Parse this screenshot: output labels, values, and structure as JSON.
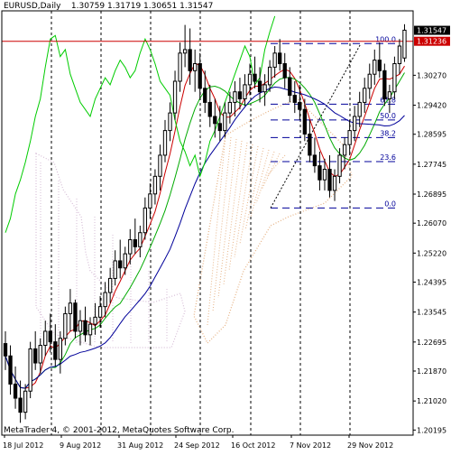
{
  "header": {
    "symbol_timeframe": "EURUSD,Daily",
    "ohlc": "1.30759 1.31719 1.30651 1.31547"
  },
  "footer": {
    "copyright": "MetaTrader 4, © 2001-2012, MetaQuotes Software Corp."
  },
  "colors": {
    "candles": "#000000",
    "ma_fast": "#cc0000",
    "ma_slow": "#000099",
    "chikou": "#00cc00",
    "cloud_up": "#e7b487",
    "cloud_down": "#d6bcd6",
    "bid_line": "#cc0000",
    "fib": "#000099",
    "axis": "#000000"
  },
  "chart_data": {
    "type": "candlestick",
    "symbol": "EURUSD",
    "timeframe": "Daily",
    "ohlc_last": {
      "open": 1.30759,
      "high": 1.31719,
      "low": 1.30651,
      "close": 1.31547
    },
    "y_ticks": [
      "1.31547",
      "1.31236",
      "1.30270",
      "1.29420",
      "1.28595",
      "1.27745",
      "1.26895",
      "1.26070",
      "1.25220",
      "1.24395",
      "1.23545",
      "1.22695",
      "1.21870",
      "1.21020",
      "1.20195"
    ],
    "y_tick_values": [
      1.31547,
      1.31236,
      1.3027,
      1.2942,
      1.28595,
      1.27745,
      1.26895,
      1.2607,
      1.2522,
      1.24395,
      1.23545,
      1.22695,
      1.2187,
      1.2102,
      1.20195
    ],
    "x_ticks": [
      "18 Jul 2012",
      "9 Aug 2012",
      "31 Aug 2012",
      "24 Sep 2012",
      "16 Oct 2012",
      "7 Nov 2012",
      "29 Nov 2012"
    ],
    "current_price": "1.31547",
    "bid_level": "1.31236",
    "fib_levels": [
      {
        "label": "100.0",
        "value": 1.3117
      },
      {
        "label": "61.8",
        "value": 1.2945
      },
      {
        "label": "50.0",
        "value": 1.29
      },
      {
        "label": "38.2",
        "value": 1.285
      },
      {
        "label": "23.6",
        "value": 1.2782
      },
      {
        "label": "0.0",
        "value": 1.265
      }
    ],
    "candles": [
      [
        1.2265,
        1.23,
        1.219,
        1.223
      ],
      [
        1.223,
        1.226,
        1.212,
        1.215
      ],
      [
        1.215,
        1.22,
        1.208,
        1.211
      ],
      [
        1.211,
        1.216,
        1.204,
        1.207
      ],
      [
        1.207,
        1.215,
        1.205,
        1.213
      ],
      [
        1.213,
        1.227,
        1.211,
        1.225
      ],
      [
        1.225,
        1.23,
        1.219,
        1.221
      ],
      [
        1.221,
        1.228,
        1.218,
        1.226
      ],
      [
        1.226,
        1.233,
        1.223,
        1.23
      ],
      [
        1.23,
        1.235,
        1.224,
        1.227
      ],
      [
        1.227,
        1.232,
        1.22,
        1.222
      ],
      [
        1.222,
        1.23,
        1.218,
        1.228
      ],
      [
        1.228,
        1.237,
        1.226,
        1.235
      ],
      [
        1.235,
        1.242,
        1.23,
        1.238
      ],
      [
        1.238,
        1.239,
        1.228,
        1.23
      ],
      [
        1.23,
        1.236,
        1.226,
        1.233
      ],
      [
        1.233,
        1.237,
        1.227,
        1.229
      ],
      [
        1.229,
        1.234,
        1.226,
        1.232
      ],
      [
        1.232,
        1.238,
        1.229,
        1.234
      ],
      [
        1.234,
        1.24,
        1.231,
        1.237
      ],
      [
        1.237,
        1.244,
        1.234,
        1.241
      ],
      [
        1.241,
        1.248,
        1.238,
        1.245
      ],
      [
        1.245,
        1.253,
        1.243,
        1.25
      ],
      [
        1.25,
        1.256,
        1.245,
        1.248
      ],
      [
        1.248,
        1.254,
        1.246,
        1.252
      ],
      [
        1.252,
        1.259,
        1.249,
        1.256
      ],
      [
        1.256,
        1.262,
        1.252,
        1.254
      ],
      [
        1.254,
        1.26,
        1.251,
        1.258
      ],
      [
        1.258,
        1.268,
        1.256,
        1.265
      ],
      [
        1.265,
        1.272,
        1.262,
        1.269
      ],
      [
        1.269,
        1.276,
        1.266,
        1.274
      ],
      [
        1.274,
        1.283,
        1.27,
        1.28
      ],
      [
        1.28,
        1.29,
        1.278,
        1.287
      ],
      [
        1.287,
        1.295,
        1.284,
        1.292
      ],
      [
        1.292,
        1.304,
        1.29,
        1.301
      ],
      [
        1.301,
        1.312,
        1.298,
        1.309
      ],
      [
        1.309,
        1.317,
        1.305,
        1.31
      ],
      [
        1.31,
        1.316,
        1.3,
        1.304
      ],
      [
        1.304,
        1.31,
        1.298,
        1.306
      ],
      [
        1.306,
        1.309,
        1.296,
        1.299
      ],
      [
        1.299,
        1.304,
        1.292,
        1.295
      ],
      [
        1.295,
        1.3,
        1.288,
        1.291
      ],
      [
        1.291,
        1.296,
        1.285,
        1.289
      ],
      [
        1.289,
        1.294,
        1.284,
        1.287
      ],
      [
        1.287,
        1.295,
        1.285,
        1.292
      ],
      [
        1.292,
        1.298,
        1.289,
        1.295
      ],
      [
        1.295,
        1.301,
        1.291,
        1.298
      ],
      [
        1.298,
        1.302,
        1.293,
        1.296
      ],
      [
        1.296,
        1.303,
        1.294,
        1.3
      ],
      [
        1.3,
        1.306,
        1.297,
        1.303
      ],
      [
        1.303,
        1.308,
        1.299,
        1.301
      ],
      [
        1.301,
        1.305,
        1.295,
        1.298
      ],
      [
        1.298,
        1.303,
        1.294,
        1.3
      ],
      [
        1.3,
        1.307,
        1.298,
        1.305
      ],
      [
        1.305,
        1.311,
        1.302,
        1.309
      ],
      [
        1.309,
        1.313,
        1.304,
        1.306
      ],
      [
        1.306,
        1.309,
        1.299,
        1.302
      ],
      [
        1.302,
        1.305,
        1.295,
        1.297
      ],
      [
        1.297,
        1.301,
        1.292,
        1.295
      ],
      [
        1.295,
        1.3,
        1.29,
        1.293
      ],
      [
        1.293,
        1.296,
        1.284,
        1.286
      ],
      [
        1.286,
        1.29,
        1.278,
        1.28
      ],
      [
        1.28,
        1.285,
        1.275,
        1.277
      ],
      [
        1.277,
        1.281,
        1.27,
        1.273
      ],
      [
        1.273,
        1.279,
        1.27,
        1.276
      ],
      [
        1.276,
        1.28,
        1.268,
        1.27
      ],
      [
        1.27,
        1.276,
        1.267,
        1.274
      ],
      [
        1.274,
        1.282,
        1.272,
        1.28
      ],
      [
        1.28,
        1.285,
        1.276,
        1.283
      ],
      [
        1.283,
        1.29,
        1.28,
        1.287
      ],
      [
        1.287,
        1.294,
        1.284,
        1.291
      ],
      [
        1.291,
        1.298,
        1.288,
        1.295
      ],
      [
        1.295,
        1.302,
        1.292,
        1.299
      ],
      [
        1.299,
        1.306,
        1.296,
        1.303
      ],
      [
        1.303,
        1.31,
        1.3,
        1.307
      ],
      [
        1.307,
        1.312,
        1.302,
        1.304
      ],
      [
        1.304,
        1.306,
        1.294,
        1.296
      ],
      [
        1.296,
        1.3,
        1.292,
        1.298
      ],
      [
        1.298,
        1.308,
        1.296,
        1.306
      ],
      [
        1.306,
        1.313,
        1.303,
        1.311
      ],
      [
        1.3076,
        1.3172,
        1.3065,
        1.3155
      ]
    ]
  }
}
